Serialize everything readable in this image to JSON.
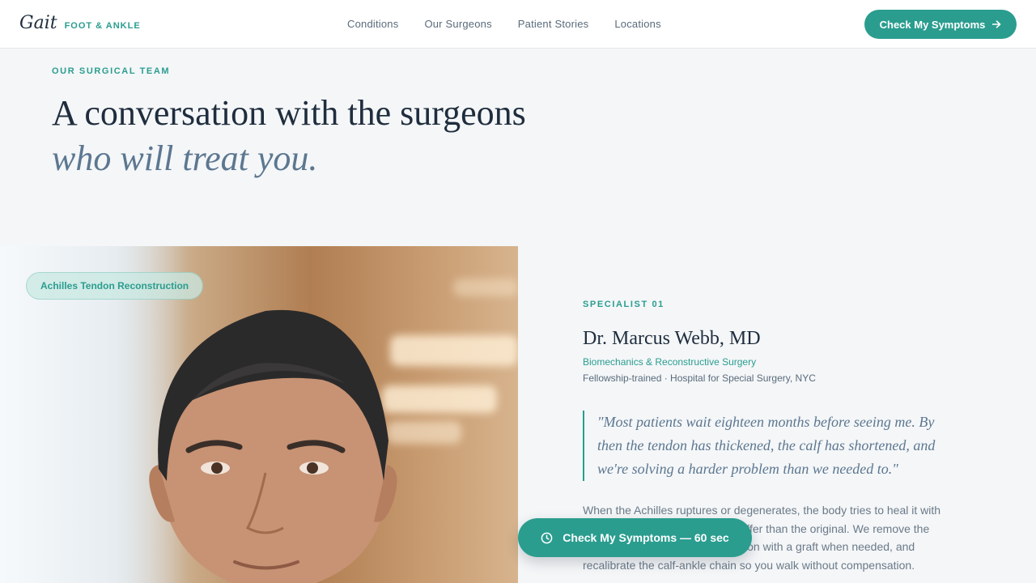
{
  "brand": {
    "script": "Gait",
    "sub": "FOOT & ANKLE"
  },
  "nav": {
    "items": [
      "Conditions",
      "Our Surgeons",
      "Patient Stories",
      "Locations"
    ]
  },
  "header_cta": {
    "label": "Check My Symptoms",
    "icon": "arrow-right-icon"
  },
  "hero": {
    "eyebrow": "OUR SURGICAL TEAM",
    "line1": "A conversation with the surgeons",
    "line2": "who will treat you."
  },
  "specialist": {
    "tag": "Achilles Tendon Reconstruction",
    "eyebrow": "SPECIALIST 01",
    "name": "Dr. Marcus Webb, MD",
    "specialty": "Biomechanics & Reconstructive Surgery",
    "credentials": "Fellowship-trained · Hospital for Special Surgery, NYC",
    "quote": "\"Most patients wait eighteen months before seeing me. By then the tendon has thickened, the calf has shortened, and we're solving a harder problem than we needed to.\"",
    "body": "When the Achilles ruptures or degenerates, the body tries to heal it with scar tissue that is weaker and stiffer than the original. We remove the damaged tissue, rebuild the tendon with a graft when needed, and recalibrate the calf-ankle chain so you walk without compensation."
  },
  "floating_cta": {
    "label": "Check My Symptoms — 60 sec",
    "icon": "clock-icon"
  },
  "colors": {
    "accent": "#2a9d8f",
    "ink": "#1f2d3d",
    "muted": "#5c7790",
    "background": "#f4f6f8"
  }
}
